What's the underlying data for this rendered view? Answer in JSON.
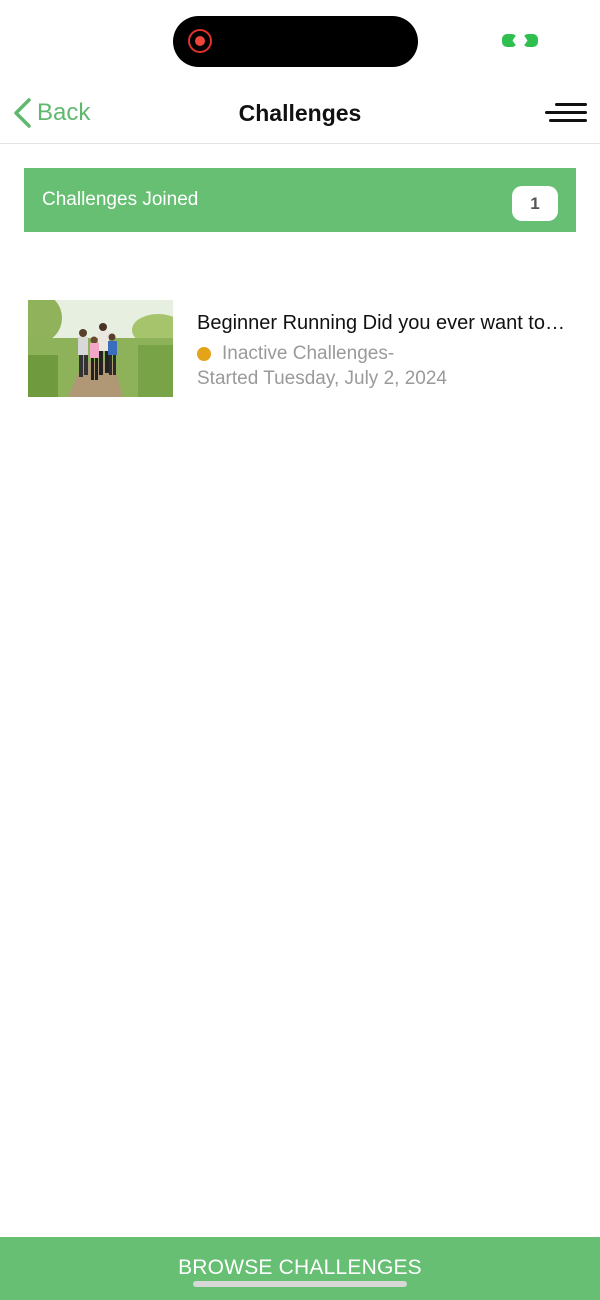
{
  "status_bar": {
    "icons": [
      "screen-recording-icon",
      "link-icon"
    ],
    "colors": {
      "recording": "#f0443a",
      "link": "#2fbf4e"
    }
  },
  "nav": {
    "back_label": "Back",
    "title": "Challenges",
    "back_icon": "chevron-left-icon",
    "menu_icon": "hamburger-menu-icon"
  },
  "joined": {
    "label": "Challenges Joined",
    "count": "1"
  },
  "challenges": [
    {
      "title": "Beginner Running Did you ever want to…",
      "status": "Inactive Challenges-",
      "status_color": "#e5a31a",
      "started": "Started Tuesday, July 2, 2024",
      "thumbnail": "family-running-photo"
    }
  ],
  "footer": {
    "browse_label": "BROWSE CHALLENGES"
  },
  "theme": {
    "accent": "#66bf73",
    "back_text": "#5fb86e",
    "muted_text": "#9a9a9a"
  }
}
